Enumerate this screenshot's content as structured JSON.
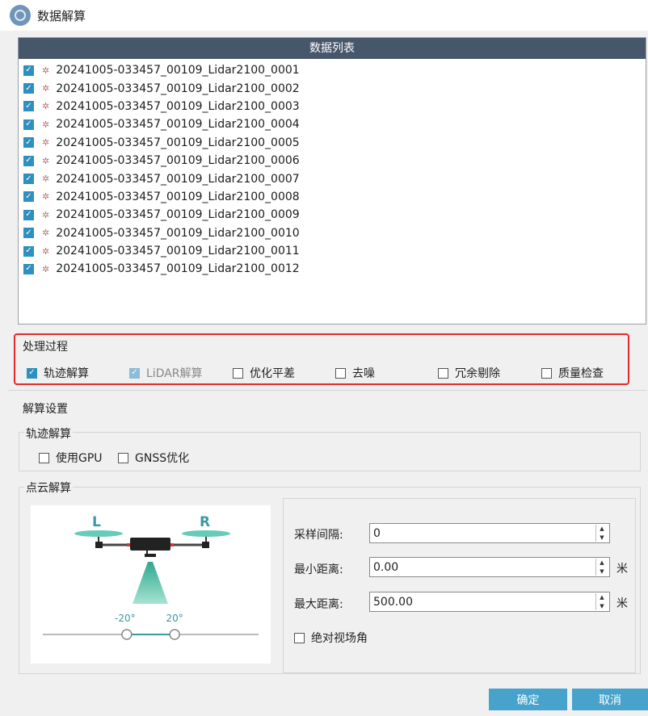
{
  "window": {
    "title": "数据解算"
  },
  "list": {
    "header": "数据列表",
    "items": [
      "20241005-033457_00109_Lidar2100_0001",
      "20241005-033457_00109_Lidar2100_0002",
      "20241005-033457_00109_Lidar2100_0003",
      "20241005-033457_00109_Lidar2100_0004",
      "20241005-033457_00109_Lidar2100_0005",
      "20241005-033457_00109_Lidar2100_0006",
      "20241005-033457_00109_Lidar2100_0007",
      "20241005-033457_00109_Lidar2100_0008",
      "20241005-033457_00109_Lidar2100_0009",
      "20241005-033457_00109_Lidar2100_0010",
      "20241005-033457_00109_Lidar2100_0011",
      "20241005-033457_00109_Lidar2100_0012"
    ]
  },
  "process": {
    "title": "处理过程",
    "options": [
      {
        "label": "轨迹解算",
        "checked": true,
        "enabled": true
      },
      {
        "label": "LiDAR解算",
        "checked": true,
        "enabled": false
      },
      {
        "label": "优化平差",
        "checked": false,
        "enabled": true
      },
      {
        "label": "去噪",
        "checked": false,
        "enabled": true
      },
      {
        "label": "冗余剔除",
        "checked": false,
        "enabled": true
      },
      {
        "label": "质量检查",
        "checked": false,
        "enabled": true
      }
    ]
  },
  "settings": {
    "title": "解算设置",
    "trajectory": {
      "title": "轨迹解算",
      "use_gpu": "使用GPU",
      "use_gpu_checked": false,
      "gnss_opt": "GNSS优化",
      "gnss_opt_checked": false
    },
    "pointcloud": {
      "title": "点云解算",
      "drone": {
        "left": "L",
        "right": "R",
        "angle_min": "-20°",
        "angle_max": "20°",
        "angle_min_value": -20,
        "angle_max_value": 20
      },
      "sample_label": "采样间隔:",
      "sample_value": "0",
      "min_label": "最小距离:",
      "min_value": "0.00",
      "max_label": "最大距离:",
      "max_value": "500.00",
      "unit": "米",
      "absolute_fov": "绝对视场角",
      "absolute_fov_checked": false
    }
  },
  "buttons": {
    "ok": "确定",
    "cancel": "取消"
  },
  "colors": {
    "accent": "#2f8fbf",
    "header": "#47576b",
    "button": "#47a3cc",
    "highlight": "#e32a2a",
    "drone_teal": "#3ab0a0"
  },
  "icons": {
    "app": "app-logo-icon",
    "list_item": "point-cloud-icon"
  }
}
